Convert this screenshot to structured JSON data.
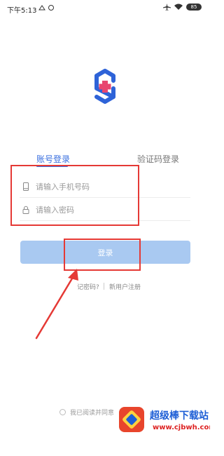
{
  "status_bar": {
    "time": "下午5:13",
    "battery": "85"
  },
  "tabs": {
    "account_login": "账号登录",
    "sms_login": "验证码登录"
  },
  "form": {
    "phone_placeholder": "请输入手机号码",
    "password_placeholder": "请输入密码",
    "login_button": "登录"
  },
  "links": {
    "forgot_password": "记密码?",
    "register": "新用户注册"
  },
  "agreement": {
    "text": "我已阅读并同意"
  },
  "watermark": {
    "title": "超级棒下载站",
    "url": "www.cjbwh.com"
  },
  "colors": {
    "brand_blue": "#3a6fdf",
    "logo_cross": "#e8456f",
    "button_disabled": "#a9c9f1",
    "annotation_red": "#e53935"
  },
  "icons": {
    "logo": "shield-hexagon-cross-icon",
    "phone": "phone-icon",
    "lock": "lock-icon"
  }
}
